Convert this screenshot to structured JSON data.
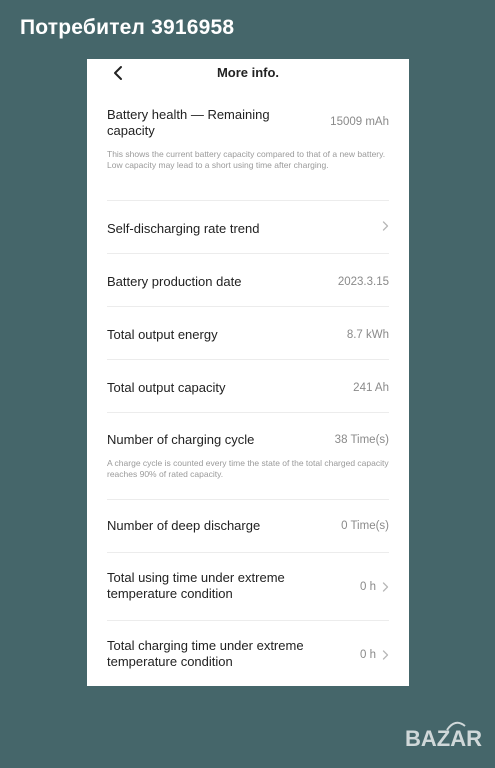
{
  "user": "Потребител 3916958",
  "nav": {
    "title": "More info."
  },
  "rows": [
    {
      "label": "Battery health — Remaining capacity",
      "value": "15009 mAh",
      "desc": "This shows the current battery capacity compared to that of a new battery. Low capacity may lead to a short using time after charging."
    },
    {
      "label": "Self-discharging rate trend",
      "value": ""
    },
    {
      "label": "Battery production date",
      "value": "2023.3.15"
    },
    {
      "label": "Total output energy",
      "value": "8.7 kWh"
    },
    {
      "label": "Total output capacity",
      "value": "241 Ah"
    },
    {
      "label": "Number of charging cycle",
      "value": "38 Time(s)",
      "desc": "A charge cycle is counted every time the state of the total charged capacity reaches 90% of rated capacity."
    },
    {
      "label": "Number of deep discharge",
      "value": "0 Time(s)"
    },
    {
      "label": "Total using time under extreme temperature condition",
      "value": "0 h"
    },
    {
      "label": "Total charging time under extreme temperature condition",
      "value": "0 h"
    }
  ],
  "watermark": "BAZAR",
  "icons": {
    "back": "chevron-left-icon",
    "chevron": "chevron-right-icon"
  }
}
